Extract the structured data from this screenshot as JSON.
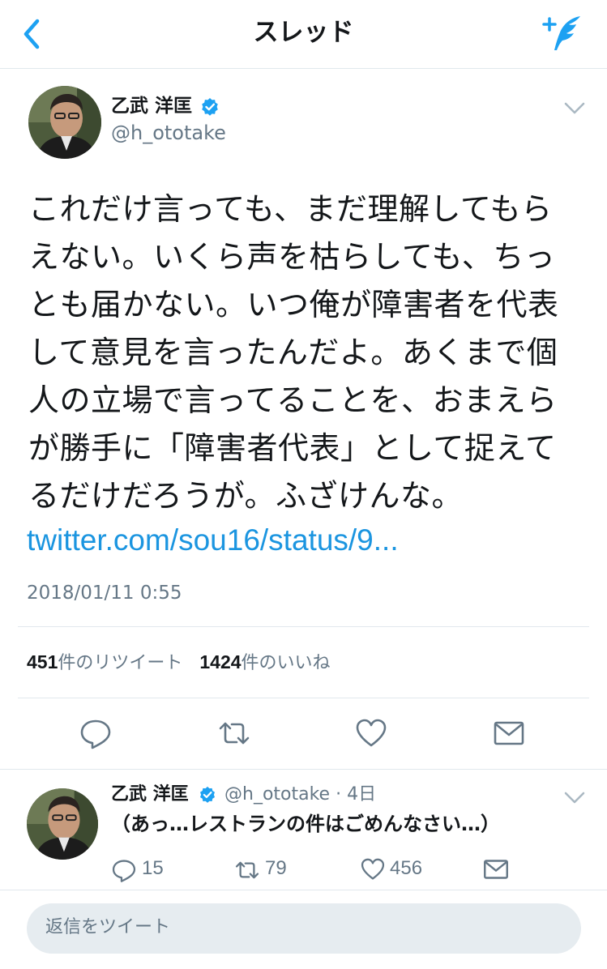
{
  "header": {
    "title": "スレッド",
    "back_icon": "back-chevron-icon",
    "compose_icon": "compose-quill-icon"
  },
  "colors": {
    "accent": "#1da1f2",
    "link": "#1b95e0",
    "muted": "#657786",
    "divider": "#e1e8ed"
  },
  "main_tweet": {
    "author": {
      "name": "乙武 洋匡",
      "handle": "@h_ototake",
      "verified": true
    },
    "lines": [
      "これだけ言っても、まだ理解してもら",
      "えない。いくら声を枯らしても、ちっ",
      "とも届かない。いつ俺が障害者を代表",
      "して意見を言ったんだよ。あくまで個",
      "人の立場で言ってることを、おまえら",
      "が勝手に「障害者代表」として捉えて",
      "るだけだろうが。ふざけんな。"
    ],
    "link": "twitter.com/sou16/status/9...",
    "timestamp": "2018/01/11 0:55",
    "stats": {
      "retweets": "451",
      "retweets_label": "件のリツイート",
      "likes": "1424",
      "likes_label": "件のいいね"
    }
  },
  "reply_tweet": {
    "author": {
      "name": "乙武 洋匡",
      "handle": "@h_ototake · 4日",
      "verified": true
    },
    "text": "（あっ…レストランの件はごめんなさい…）",
    "replies": "15",
    "retweets": "79",
    "likes": "456"
  },
  "composer": {
    "placeholder": "返信をツイート"
  }
}
